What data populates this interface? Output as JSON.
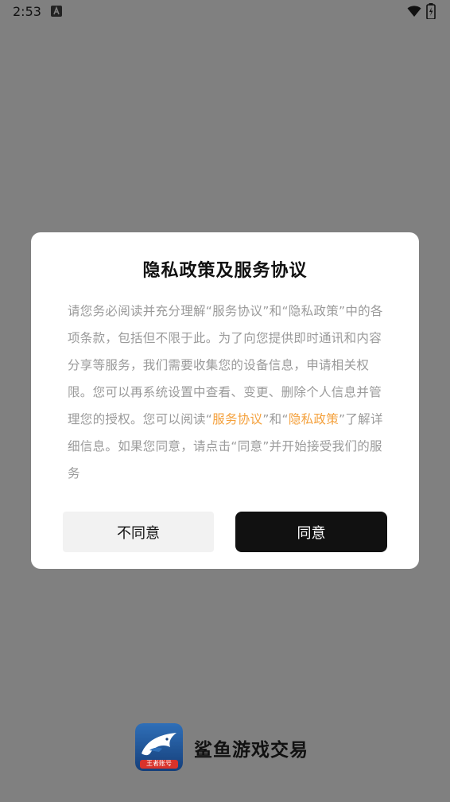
{
  "status_bar": {
    "time": "2:53",
    "icons": [
      "a-notification-icon",
      "wifi-icon",
      "battery-icon"
    ]
  },
  "dialog": {
    "title": "隐私政策及服务协议",
    "body_text_1": "请您务必阅读并充分理解“服务协议”和“隐私政策”中的各项条款，包括但不限于此。为了向您提供即时通讯和内容分享等服务，我们需要收集您的设备信息，申请相关权限。您可以再系统设置中查看、变更、删除个人信息并管理您的授权。您可以阅读“",
    "link_service": "服务协议",
    "body_text_2": "”和“",
    "link_privacy": "隐私政策",
    "body_text_3": "”了解详细信息。如果您同意，请点击“同意”并开始接受我们的服务",
    "disagree_label": "不同意",
    "agree_label": "同意"
  },
  "brand": {
    "name": "鲨鱼游戏交易",
    "logo_label": "王者账号"
  },
  "colors": {
    "overlay": "#808080",
    "link": "#f4a03b",
    "primary_button": "#111111"
  }
}
